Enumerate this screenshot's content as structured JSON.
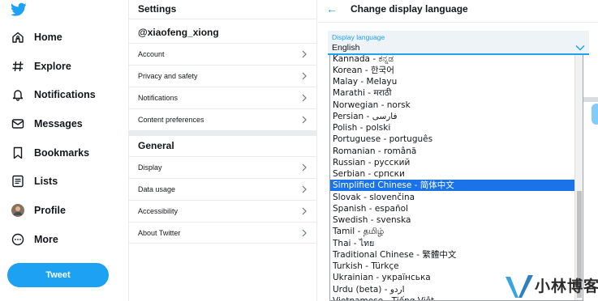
{
  "brand": {
    "accent": "#1da1f2",
    "selection": "#1a73e8"
  },
  "nav": {
    "logo": "bird-logo",
    "items": [
      {
        "label": "Home",
        "icon": "home-icon"
      },
      {
        "label": "Explore",
        "icon": "hashtag-icon"
      },
      {
        "label": "Notifications",
        "icon": "bell-icon"
      },
      {
        "label": "Messages",
        "icon": "envelope-icon"
      },
      {
        "label": "Bookmarks",
        "icon": "bookmark-icon"
      },
      {
        "label": "Lists",
        "icon": "list-icon"
      },
      {
        "label": "Profile",
        "icon": "avatar-icon"
      },
      {
        "label": "More",
        "icon": "more-icon"
      }
    ],
    "tweet_label": "Tweet"
  },
  "settings": {
    "title": "Settings",
    "username": "@xiaofeng_xiong",
    "account_items": [
      "Account",
      "Privacy and safety",
      "Notifications",
      "Content preferences"
    ],
    "general_title": "General",
    "general_items": [
      "Display",
      "Data usage",
      "Accessibility",
      "About Twitter"
    ]
  },
  "language": {
    "back_icon": "arrow-left-icon",
    "title": "Change display language",
    "select_label": "Display language",
    "select_value": "English",
    "options": [
      "Kannada - ಕನ್ನಡ",
      "Korean - 한국어",
      "Malay - Melayu",
      "Marathi - मराठी",
      "Norwegian - norsk",
      "Persian - فارسی",
      "Polish - polski",
      "Portuguese - português",
      "Romanian - română",
      "Russian - русский",
      "Serbian - српски",
      "Simplified Chinese - 简体中文",
      "Slovak - slovenčina",
      "Spanish - español",
      "Swedish - svenska",
      "Tamil - தமிழ்",
      "Thai - ไทย",
      "Traditional Chinese - 繁體中文",
      "Turkish - Türkçe",
      "Ukrainian - українська",
      "Urdu (beta) - اردو",
      "Vietnamese - Tiếng Việt"
    ],
    "selected_option": "Simplified Chinese - 简体中文"
  },
  "watermark": {
    "text": "小林博客"
  }
}
